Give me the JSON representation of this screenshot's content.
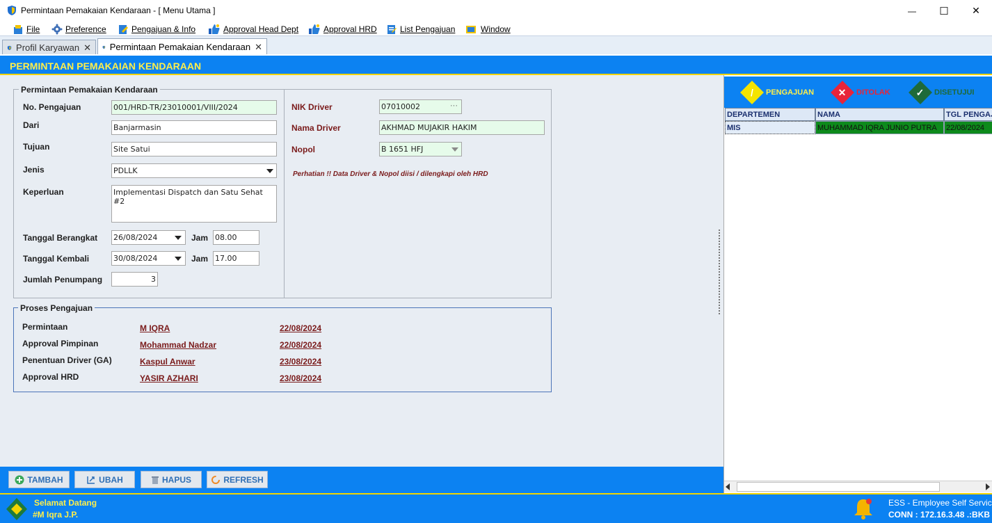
{
  "window": {
    "title": "Permintaan Pemakaian Kendaraan - [ Menu Utama ]",
    "minimize_glyph": "—",
    "maximize_glyph": "☐",
    "close_glyph": "✕"
  },
  "menu": [
    {
      "label": "File",
      "icon": "file-icon"
    },
    {
      "label": "Preference",
      "icon": "gear-icon"
    },
    {
      "label": "Pengajuan & Info",
      "icon": "edit-icon"
    },
    {
      "label": "Approval Head Dept",
      "icon": "thumbs-up-icon"
    },
    {
      "label": "Approval HRD",
      "icon": "thumbs-up-icon"
    },
    {
      "label": "List Pengajuan",
      "icon": "list-icon"
    },
    {
      "label": "Window",
      "icon": "window-icon"
    }
  ],
  "tabs": [
    {
      "label": "Profil Karyawan",
      "active": false
    },
    {
      "label": "Permintaan Pemakaian Kendaraan",
      "active": true
    }
  ],
  "tab_close_glyph": "✕",
  "page_title": "PERMINTAAN PEMAKAIAN KENDARAAN",
  "form": {
    "group_title": "Permintaan Pemakaian Kendaraan",
    "no_pengajuan_label": "No. Pengajuan",
    "no_pengajuan": "001/HRD-TR/23010001/VIII/2024",
    "dari_label": "Dari",
    "dari": "Banjarmasin",
    "tujuan_label": "Tujuan",
    "tujuan": "Site Satui",
    "jenis_label": "Jenis",
    "jenis": "PDLLK",
    "keperluan_label": "Keperluan",
    "keperluan": "Implementasi Dispatch dan Satu Sehat #2",
    "tgl_berangkat_label": "Tanggal Berangkat",
    "tgl_berangkat": "26/08/2024",
    "jam_label": "Jam",
    "jam_berangkat": "08.00",
    "tgl_kembali_label": "Tanggal Kembali",
    "tgl_kembali": "30/08/2024",
    "jam_kembali": "17.00",
    "jumlah_label": "Jumlah Penumpang",
    "jumlah": "3",
    "nik_driver_label": "NIK Driver",
    "nik_driver": "07010002",
    "nik_browse": "···",
    "nama_driver_label": "Nama Driver",
    "nama_driver": "AKHMAD MUJAKIR HAKIM",
    "nopol_label": "Nopol",
    "nopol": "B 1651 HFJ",
    "note": "Perhatian !! Data Driver & Nopol diisi / dilengkapi oleh HRD"
  },
  "proses": {
    "group_title": "Proses Pengajuan",
    "rows": [
      {
        "label": "Permintaan",
        "name": "M IQRA",
        "date": "22/08/2024"
      },
      {
        "label": "Approval Pimpinan",
        "name": "Mohammad Nadzar",
        "date": "22/08/2024"
      },
      {
        "label": "Penentuan Driver (GA)",
        "name": "Kaspul Anwar",
        "date": "23/08/2024"
      },
      {
        "label": "Approval HRD",
        "name": "YASIR AZHARI",
        "date": "23/08/2024"
      }
    ]
  },
  "buttons": {
    "tambah": "TAMBAH",
    "ubah": "UBAH",
    "hapus": "HAPUS",
    "refresh": "REFRESH"
  },
  "legend": {
    "pengajuan": "PENGAJUAN",
    "ditolak": "DITOLAK",
    "disetujui": "DISETUJUI",
    "colors": {
      "pengajuan": "#f4e400",
      "ditolak": "#e8243a",
      "disetujui": "#1e6a3a"
    }
  },
  "grid": {
    "headers": [
      "DEPARTEMEN",
      "NAMA",
      "TGL PENGAJUAN"
    ],
    "rows": [
      {
        "departemen": "MIS",
        "nama": "MUHAMMAD IQRA JUNIO PUTRA",
        "tgl": "22/08/2024"
      }
    ]
  },
  "status": {
    "welcome": "Selamat Datang",
    "user": "#M Iqra J.P.",
    "app": "ESS - Employee Self Service",
    "conn": "CONN : 172.16.3.48 .:BKB"
  },
  "colors": {
    "accent_blue": "#0c82f2",
    "header_yellow": "#ffef4a",
    "row_green": "#0d8a1c"
  }
}
